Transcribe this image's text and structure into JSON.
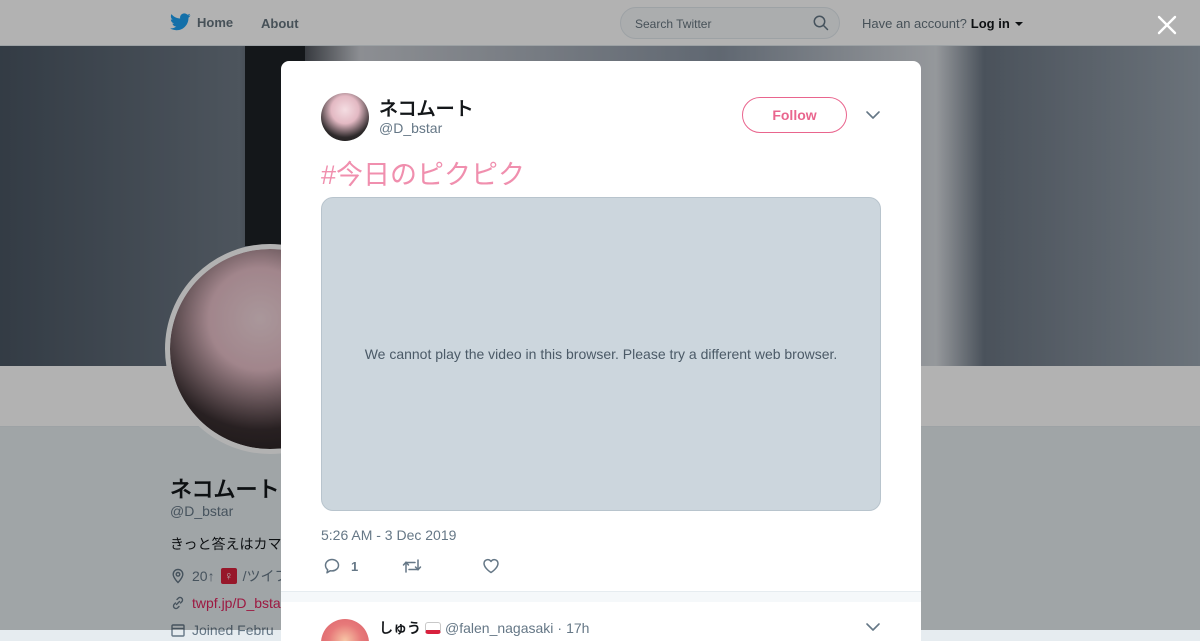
{
  "topbar": {
    "home_label": "Home",
    "about_label": "About",
    "search_placeholder": "Search Twitter",
    "account_prompt": "Have an account?",
    "login_label": "Log in"
  },
  "profile": {
    "name": "ネコムート",
    "handle": "@D_bstar",
    "bio": "きっと答えはカマ",
    "location_prefix": "20↑",
    "location_emoji": "♀",
    "location_suffix": "/ツイフ",
    "url": "twpf.jp/D_bsta",
    "joined": "Joined Febru"
  },
  "tweet": {
    "author_name": "ネコムート",
    "author_handle": "@D_bstar",
    "follow_label": "Follow",
    "text": "#今日のピクピク",
    "media_message": "We cannot play the video in this browser. Please try a different web browser.",
    "timestamp": "5:26 AM - 3 Dec 2019",
    "reply_count": "1",
    "retweet_count": "",
    "like_count": ""
  },
  "reply": {
    "name": "しゅう",
    "handle": "@falen_nagasaki",
    "separator": "·",
    "time": "17h"
  },
  "colors": {
    "accent": "#e0245e",
    "hashtag": "#f08fae",
    "twitter_blue": "#1da1f2",
    "media_bg": "#ccd6dd"
  },
  "icons": {
    "logo": "twitter-bird-icon",
    "search": "search-icon",
    "close": "close-icon",
    "reply": "reply-icon",
    "retweet": "retweet-icon",
    "like": "heart-icon",
    "more": "chevron-down-icon"
  }
}
